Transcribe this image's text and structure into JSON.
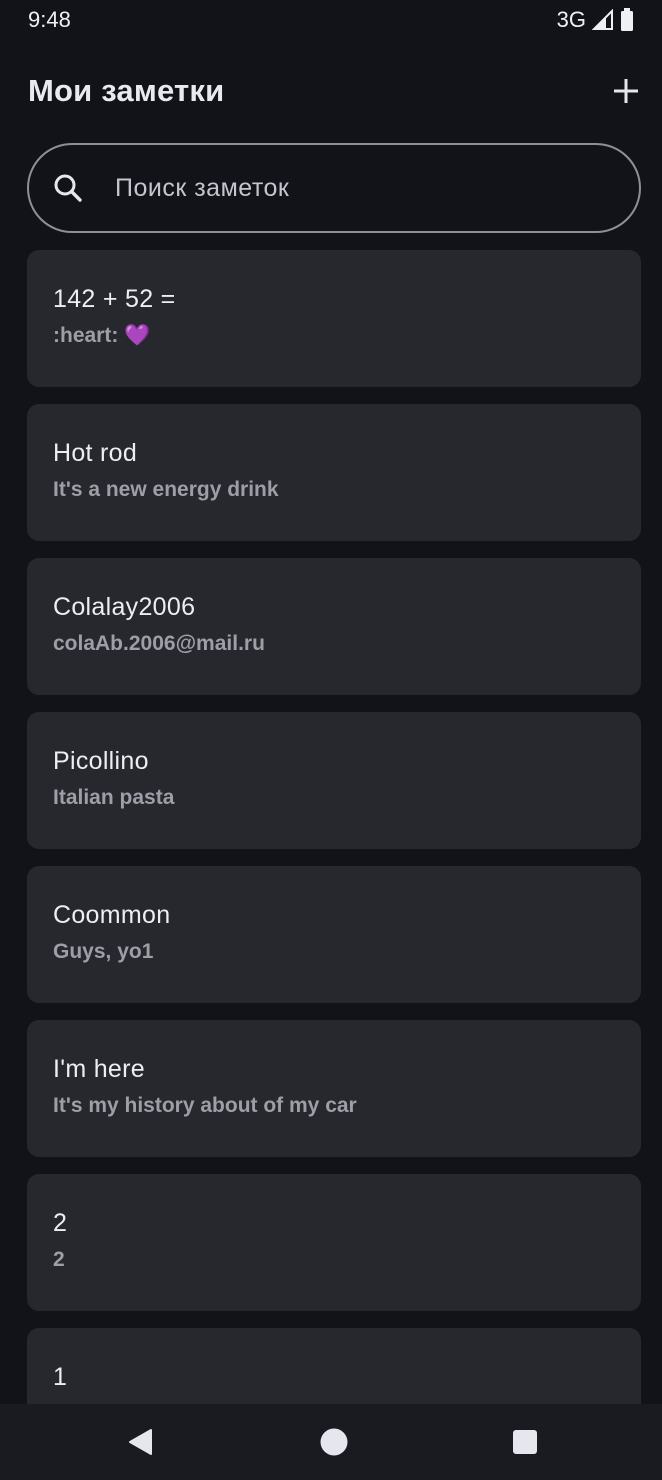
{
  "status_bar": {
    "time": "9:48",
    "network": "3G"
  },
  "header": {
    "title": "Мои заметки",
    "add_icon": "plus-icon"
  },
  "search": {
    "placeholder": "Поиск заметок",
    "value": "",
    "icon": "search-icon"
  },
  "notes": [
    {
      "title": "142 + 52 =",
      "body": ":heart: 💜"
    },
    {
      "title": "Hot rod",
      "body": "It's a new energy drink"
    },
    {
      "title": "Colalay2006",
      "body": "colaAb.2006@mail.ru"
    },
    {
      "title": "Picollino",
      "body": "Italian pasta"
    },
    {
      "title": "Coommon",
      "body": "Guys, yo1"
    },
    {
      "title": "I'm here",
      "body": "It's my history about of my car"
    },
    {
      "title": "2",
      "body": "2"
    },
    {
      "title": "1",
      "body": ""
    }
  ],
  "nav": {
    "back_icon": "back-triangle-icon",
    "home_icon": "home-circle-icon",
    "recents_icon": "recents-square-icon"
  },
  "colors": {
    "background": "#121319",
    "card": "#27282e",
    "title_text": "#eceef4",
    "body_text": "#9c9ea8",
    "search_border": "#8e9099",
    "nav_background": "#1a1b21"
  }
}
